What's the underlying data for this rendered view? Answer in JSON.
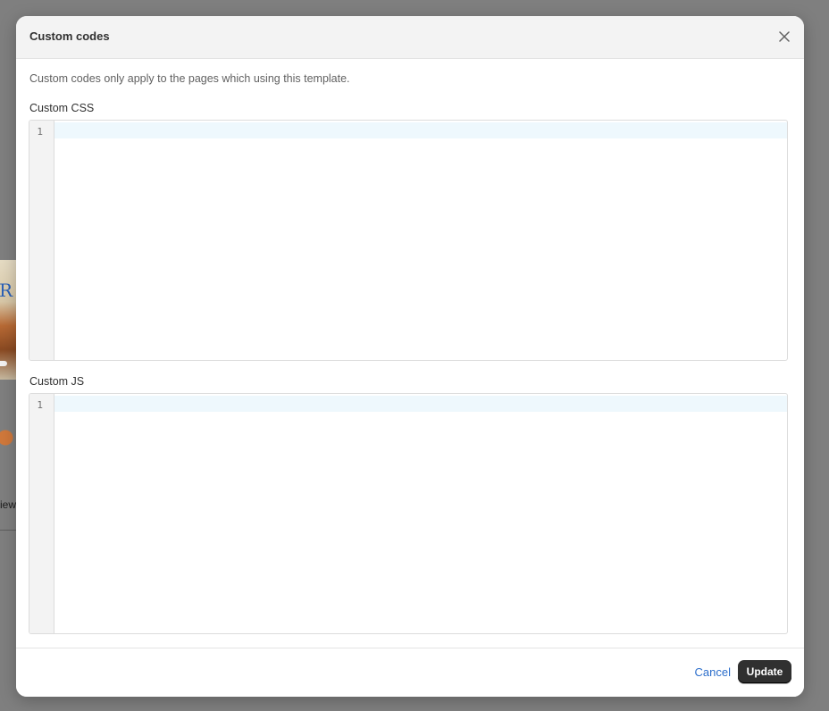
{
  "background": {
    "partial_text": "iew"
  },
  "modal": {
    "title": "Custom codes",
    "description": "Custom codes only apply to the pages which using this template.",
    "css_editor": {
      "label": "Custom CSS",
      "line_numbers": [
        "1"
      ],
      "value": ""
    },
    "js_editor": {
      "label": "Custom JS",
      "line_numbers": [
        "1"
      ],
      "value": ""
    },
    "footer": {
      "cancel_label": "Cancel",
      "update_label": "Update"
    }
  },
  "colors": {
    "overlay": "#7f7f7f",
    "header_bg": "#f3f3f3",
    "link": "#2c6ecb",
    "primary_button": "#303030",
    "active_line": "#eef8fd"
  },
  "icons": {
    "close": "close-icon"
  }
}
